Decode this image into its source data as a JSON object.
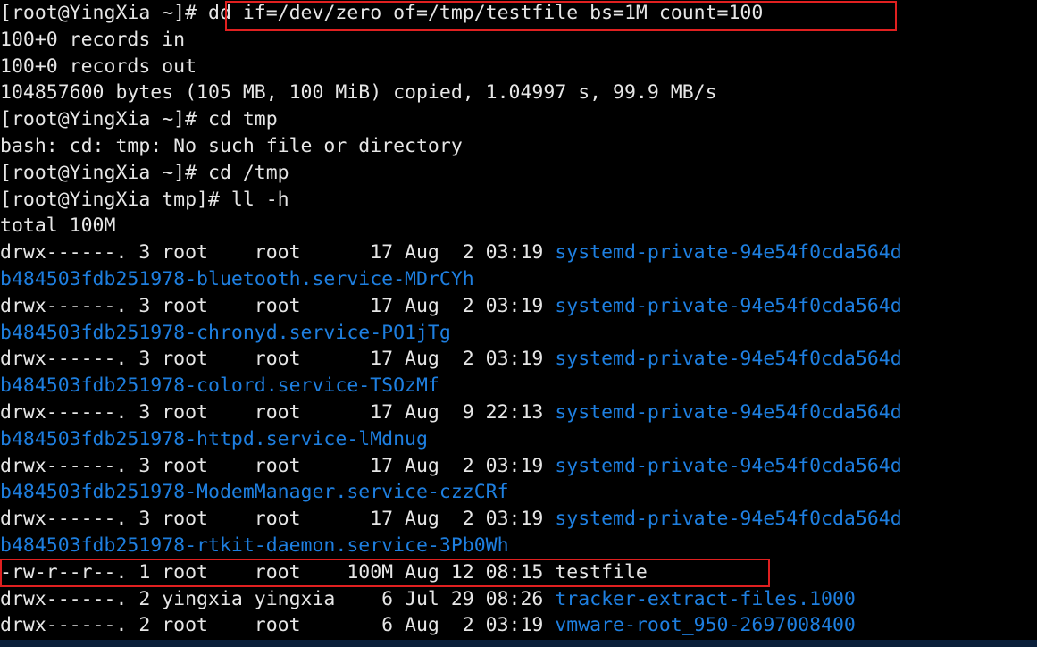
{
  "terminal": {
    "colors": {
      "background": "#000000",
      "text": "#e6e6e6",
      "directory": "#1e7fe0",
      "highlight": "#e02020"
    },
    "lines": [
      {
        "segments": [
          {
            "text": "[root@YingXia ~]# "
          },
          {
            "text": "dd if=/dev/zero of=/tmp/testfile bs=1M count=100"
          }
        ]
      },
      {
        "segments": [
          {
            "text": "100+0 records in"
          }
        ]
      },
      {
        "segments": [
          {
            "text": "100+0 records out"
          }
        ]
      },
      {
        "segments": [
          {
            "text": "104857600 bytes (105 MB, 100 MiB) copied, 1.04997 s, 99.9 MB/s"
          }
        ]
      },
      {
        "segments": [
          {
            "text": "[root@YingXia ~]# cd tmp"
          }
        ]
      },
      {
        "segments": [
          {
            "text": "bash: cd: tmp: No such file or directory"
          }
        ]
      },
      {
        "segments": [
          {
            "text": "[root@YingXia ~]# cd /tmp"
          }
        ]
      },
      {
        "segments": [
          {
            "text": "[root@YingXia tmp]# ll -h"
          }
        ]
      },
      {
        "segments": [
          {
            "text": "total 100M"
          }
        ]
      },
      {
        "segments": [
          {
            "text": "drwx------. 3 root    root      17 Aug  2 03:19 "
          },
          {
            "text": "systemd-private-94e54f0cda564d",
            "dir": true
          }
        ]
      },
      {
        "segments": [
          {
            "text": "b484503fdb251978-bluetooth.service-MDrCYh",
            "dir": true
          }
        ]
      },
      {
        "segments": [
          {
            "text": "drwx------. 3 root    root      17 Aug  2 03:19 "
          },
          {
            "text": "systemd-private-94e54f0cda564d",
            "dir": true
          }
        ]
      },
      {
        "segments": [
          {
            "text": "b484503fdb251978-chronyd.service-PO1jTg",
            "dir": true
          }
        ]
      },
      {
        "segments": [
          {
            "text": "drwx------. 3 root    root      17 Aug  2 03:19 "
          },
          {
            "text": "systemd-private-94e54f0cda564d",
            "dir": true
          }
        ]
      },
      {
        "segments": [
          {
            "text": "b484503fdb251978-colord.service-TSOzMf",
            "dir": true
          }
        ]
      },
      {
        "segments": [
          {
            "text": "drwx------. 3 root    root      17 Aug  9 22:13 "
          },
          {
            "text": "systemd-private-94e54f0cda564d",
            "dir": true
          }
        ]
      },
      {
        "segments": [
          {
            "text": "b484503fdb251978-httpd.service-lMdnug",
            "dir": true
          }
        ]
      },
      {
        "segments": [
          {
            "text": "drwx------. 3 root    root      17 Aug  2 03:19 "
          },
          {
            "text": "systemd-private-94e54f0cda564d",
            "dir": true
          }
        ]
      },
      {
        "segments": [
          {
            "text": "b484503fdb251978-ModemManager.service-czzCRf",
            "dir": true
          }
        ]
      },
      {
        "segments": [
          {
            "text": "drwx------. 3 root    root      17 Aug  2 03:19 "
          },
          {
            "text": "systemd-private-94e54f0cda564d",
            "dir": true
          }
        ]
      },
      {
        "segments": [
          {
            "text": "b484503fdb251978-rtkit-daemon.service-3Pb0Wh",
            "dir": true
          }
        ]
      },
      {
        "segments": [
          {
            "text": "-rw-r--r--. 1 root    root    100M Aug 12 08:15 testfile"
          }
        ]
      },
      {
        "segments": [
          {
            "text": "drwx------. 2 yingxia yingxia    6 Jul 29 08:26 "
          },
          {
            "text": "tracker-extract-files.1000",
            "dir": true
          }
        ]
      },
      {
        "segments": [
          {
            "text": "drwx------. 2 root    root       6 Aug  2 03:19 "
          },
          {
            "text": "vmware-root_950-2697008400",
            "dir": true
          }
        ]
      }
    ]
  }
}
